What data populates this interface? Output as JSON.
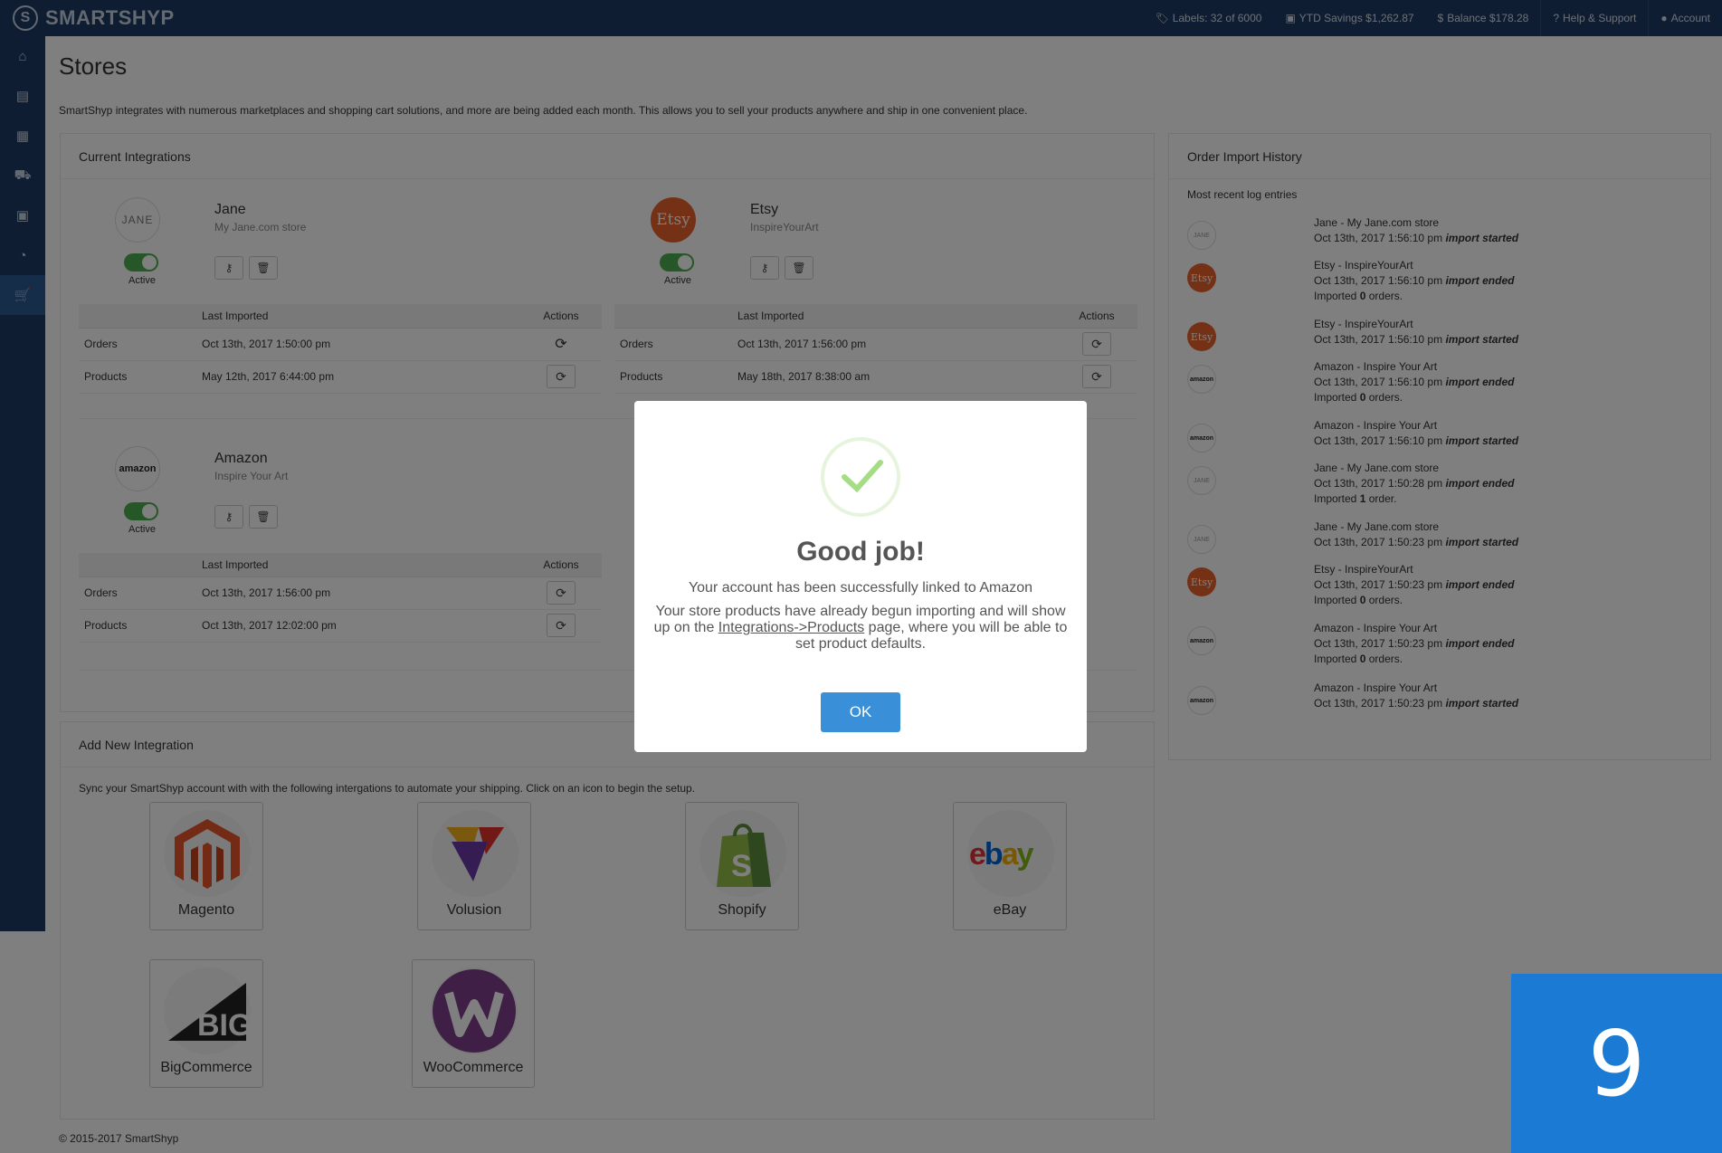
{
  "app": {
    "name": "SMARTSHYP",
    "logo_glyph": "S"
  },
  "topbar": {
    "labels": "Labels: 32 of 6000",
    "ytd": "YTD Savings $1,262.87",
    "balance": "Balance $178.28",
    "help": "Help & Support",
    "account": "Account"
  },
  "sidebar": {
    "items": [
      {
        "icon": "home-icon"
      },
      {
        "icon": "store-icon"
      },
      {
        "icon": "calendar-icon"
      },
      {
        "icon": "truck-icon"
      },
      {
        "icon": "address-book-icon"
      },
      {
        "icon": "pie-chart-icon"
      },
      {
        "icon": "cart-icon",
        "active": true
      }
    ]
  },
  "page": {
    "title": "Stores",
    "description": "SmartShyp integrates with numerous marketplaces and shopping cart solutions, and more are being added each month. This allows you to sell your products anywhere and ship in one convenient place."
  },
  "current": {
    "heading": "Current Integrations",
    "col_last": "Last Imported",
    "col_actions": "Actions",
    "active_label": "Active",
    "stores": [
      {
        "logo": "JANE",
        "name": "Jane",
        "sub": "My Jane.com store",
        "rows": [
          {
            "label": "Orders",
            "date": "Oct 13th, 2017 1:50:00 pm"
          },
          {
            "label": "Products",
            "date": "May 12th, 2017 6:44:00 pm"
          }
        ]
      },
      {
        "logo": "Etsy",
        "name": "Etsy",
        "sub": "InspireYourArt",
        "rows": [
          {
            "label": "Orders",
            "date": "Oct 13th, 2017 1:56:00 pm"
          },
          {
            "label": "Products",
            "date": "May 18th, 2017 8:38:00 am"
          }
        ]
      },
      {
        "logo": "amazon",
        "name": "Amazon",
        "sub": "Inspire Your Art",
        "rows": [
          {
            "label": "Orders",
            "date": "Oct 13th, 2017 1:56:00 pm"
          },
          {
            "label": "Products",
            "date": "Oct 13th, 2017 12:02:00 pm"
          }
        ]
      }
    ]
  },
  "add_new": {
    "heading": "Add New Integration",
    "description": "Sync your SmartShyp account with with the following intergations to automate your shipping. Click on an icon to begin the setup.",
    "tiles": [
      "Magento",
      "Volusion",
      "Shopify",
      "eBay",
      "BigCommerce",
      "WooCommerce"
    ]
  },
  "history": {
    "heading": "Order Import History",
    "subheading": "Most recent log entries",
    "entries": [
      {
        "logo": "JANE",
        "store": "Jane - My Jane.com store",
        "time": "Oct 13th, 2017 1:56:10 pm",
        "event": "import started",
        "result_pre": "",
        "result_count": "",
        "result_post": ""
      },
      {
        "logo": "Etsy",
        "store": "Etsy - InspireYourArt",
        "time": "Oct 13th, 2017 1:56:10 pm",
        "event": "import ended",
        "result_pre": "Imported ",
        "result_count": "0",
        "result_post": " orders."
      },
      {
        "logo": "Etsy",
        "store": "Etsy - InspireYourArt",
        "time": "Oct 13th, 2017 1:56:10 pm",
        "event": "import started",
        "result_pre": "",
        "result_count": "",
        "result_post": ""
      },
      {
        "logo": "amazon",
        "store": "Amazon - Inspire Your Art",
        "time": "Oct 13th, 2017 1:56:10 pm",
        "event": "import ended",
        "result_pre": "Imported ",
        "result_count": "0",
        "result_post": " orders."
      },
      {
        "logo": "amazon",
        "store": "Amazon - Inspire Your Art",
        "time": "Oct 13th, 2017 1:56:10 pm",
        "event": "import started",
        "result_pre": "",
        "result_count": "",
        "result_post": ""
      },
      {
        "logo": "JANE",
        "store": "Jane - My Jane.com store",
        "time": "Oct 13th, 2017 1:50:28 pm",
        "event": "import ended",
        "result_pre": "Imported ",
        "result_count": "1",
        "result_post": " order."
      },
      {
        "logo": "JANE",
        "store": "Jane - My Jane.com store",
        "time": "Oct 13th, 2017 1:50:23 pm",
        "event": "import started",
        "result_pre": "",
        "result_count": "",
        "result_post": ""
      },
      {
        "logo": "Etsy",
        "store": "Etsy - InspireYourArt",
        "time": "Oct 13th, 2017 1:50:23 pm",
        "event": "import ended",
        "result_pre": "Imported ",
        "result_count": "0",
        "result_post": " orders."
      },
      {
        "logo": "amazon",
        "store": "Amazon - Inspire Your Art",
        "time": "Oct 13th, 2017 1:50:23 pm",
        "event": "import ended",
        "result_pre": "Imported ",
        "result_count": "0",
        "result_post": " orders."
      },
      {
        "logo": "amazon",
        "store": "Amazon - Inspire Your Art",
        "time": "Oct 13th, 2017 1:50:23 pm",
        "event": "import started",
        "result_pre": "",
        "result_count": "",
        "result_post": ""
      }
    ]
  },
  "footer": "© 2015-2017 SmartShyp",
  "modal": {
    "title": "Good job!",
    "line1": "Your account has been successfully linked to Amazon",
    "line2_pre": "Your store products have already begun importing and will show up on the ",
    "line2_link": "Integrations->Products",
    "line2_post": " page, where you will be able to set product defaults.",
    "ok": "OK"
  },
  "step_badge": "9",
  "colors": {
    "navy": "#1f3b64",
    "accent": "#3a8fd9",
    "etsy": "#e8622a",
    "toggle": "#4caf50"
  }
}
